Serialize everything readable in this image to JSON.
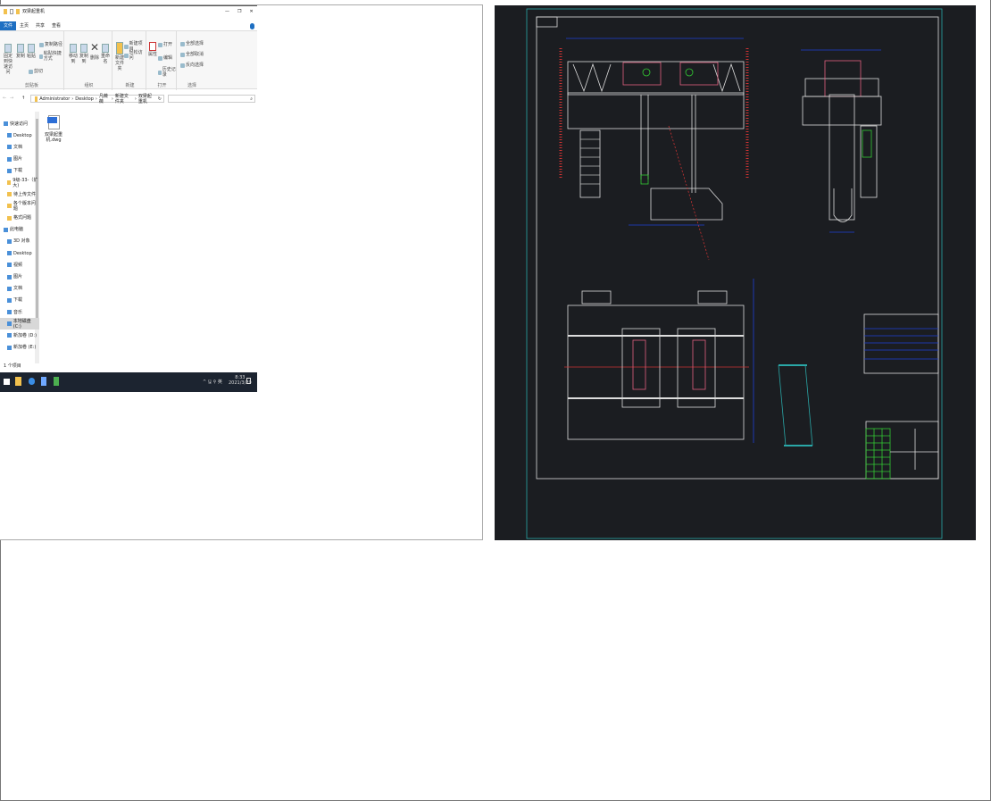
{
  "explorer": {
    "title": "双梁起重机",
    "window_controls": [
      "—",
      "❐",
      "✕"
    ],
    "tabs": [
      "文件",
      "主页",
      "共享",
      "查看"
    ],
    "ribbon": {
      "clipboard": {
        "label": "剪贴板",
        "pin": "固定到快速访问",
        "copy": "复制",
        "paste": "粘贴",
        "copy_path": "复制路径",
        "paste_shortcut": "粘贴快捷方式",
        "cut": "剪切"
      },
      "organize": {
        "label": "组织",
        "move_to": "移动到",
        "copy_to": "复制到",
        "delete": "删除",
        "rename": "重命名"
      },
      "new": {
        "label": "新建",
        "new_item": "新建项目",
        "easy_access": "轻松访问",
        "new_folder": "新建文件夹"
      },
      "open": {
        "label": "打开",
        "properties": "属性",
        "open": "打开",
        "edit": "编辑",
        "history": "历史记录"
      },
      "select": {
        "label": "选择",
        "select_all": "全部选择",
        "select_none": "全部取消",
        "invert": "反向选择"
      }
    },
    "breadcrumb": [
      "Administrator",
      "Desktop",
      "凡薇薇",
      "新建文件夹",
      "双梁起重机"
    ],
    "nav_items": [
      {
        "label": "快速访问",
        "icon": "star-icon"
      },
      {
        "label": "Desktop",
        "icon": "desktop-icon"
      },
      {
        "label": "文档",
        "icon": "document-icon"
      },
      {
        "label": "图片",
        "icon": "picture-icon"
      },
      {
        "label": "下载",
        "icon": "download-icon"
      },
      {
        "label": "9级-33-（扩大)",
        "icon": "folder-icon"
      },
      {
        "label": "待上传文件",
        "icon": "folder-icon"
      },
      {
        "label": "各个版本问题",
        "icon": "folder-icon"
      },
      {
        "label": "格式问题",
        "icon": "folder-icon"
      },
      {
        "label": "此电脑",
        "icon": "computer-icon"
      },
      {
        "label": "3D 对象",
        "icon": "cube-icon"
      },
      {
        "label": "Desktop",
        "icon": "desktop-icon"
      },
      {
        "label": "视频",
        "icon": "video-icon"
      },
      {
        "label": "图片",
        "icon": "picture-icon"
      },
      {
        "label": "文档",
        "icon": "document-icon"
      },
      {
        "label": "下载",
        "icon": "download-icon"
      },
      {
        "label": "音乐",
        "icon": "music-icon"
      },
      {
        "label": "本地磁盘 (C:)",
        "icon": "drive-icon"
      },
      {
        "label": "新加卷 (D:)",
        "icon": "drive-icon"
      },
      {
        "label": "新加卷 (E:)",
        "icon": "drive-icon"
      }
    ],
    "file": {
      "name": "双梁起重机.dwg",
      "icon": "dwg-file-icon"
    },
    "status": "1 个项目",
    "taskbar": {
      "time": "8:33",
      "date": "2021/3/29",
      "tray": "^ 🖫 ⚲ 英"
    }
  },
  "colors": {
    "cad_background": "#1b1d21",
    "cad_frame": "#2aa7a7",
    "dimension": "#1f3fd6",
    "accent": "#1e6fc2"
  }
}
